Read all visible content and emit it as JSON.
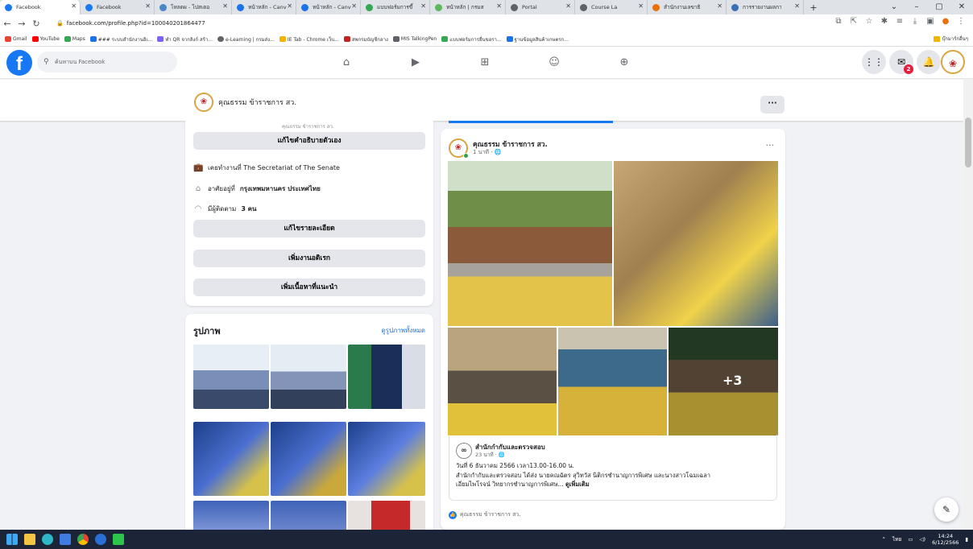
{
  "browser": {
    "tabs": [
      {
        "label": "Facebook",
        "color": "#1877f2",
        "active": true
      },
      {
        "label": "Facebook",
        "color": "#1877f2"
      },
      {
        "label": "โหลดผ - โปสเตอ",
        "color": "#4a86c8"
      },
      {
        "label": "หน้าหลัก - Canv",
        "color": "#1a73e8"
      },
      {
        "label": "หน้าหลัก - Canv",
        "color": "#1a73e8"
      },
      {
        "label": "แบบฟอร์มการขึ้",
        "color": "#34a853"
      },
      {
        "label": "หน้าหลัก | กรมส",
        "color": "#5bb85d"
      },
      {
        "label": "Portal",
        "color": "#5f6368"
      },
      {
        "label": "Course La",
        "color": "#5f6368"
      },
      {
        "label": "สำนักงานเลขาธิ",
        "color": "#e8710a"
      },
      {
        "label": "การรายงานผลกา",
        "color": "#3b6fb6"
      }
    ],
    "url": "facebook.com/profile.php?id=100040201864477",
    "bookmarks": [
      {
        "label": "Gmail",
        "color": "#ea4335"
      },
      {
        "label": "YouTube",
        "color": "#ff0000"
      },
      {
        "label": "Maps",
        "color": "#34a853"
      },
      {
        "label": "### ระบบสำนักงานอิเ...",
        "color": "#1a73e8"
      },
      {
        "label": "ทำ QR จากลิงก์ สร้า...",
        "color": "#7b61ff"
      },
      {
        "label": "e-Learning | กรมส่ง...",
        "color": "#5f6368"
      },
      {
        "label": "IE Tab - Chrome เว็บ...",
        "color": "#f4b400"
      },
      {
        "label": "สพกรมบัญชีกลาง",
        "color": "#c5221f"
      },
      {
        "label": "MIS TalkingPen",
        "color": "#5f6368"
      },
      {
        "label": "แบบฟอร์มการยื่นขอรา...",
        "color": "#34a853"
      },
      {
        "label": "ฐานข้อมูลสินค้าเกษตรก...",
        "color": "#1a73e8"
      }
    ],
    "bookmarks_other": "บุ๊กมาร์กอื่นๆ",
    "window_controls": [
      "⌄",
      "–",
      "▢",
      "✕"
    ]
  },
  "fb": {
    "search_placeholder": "ค้นหาบน Facebook",
    "notification_count": "2",
    "profile_name": "คุณธรรม ข้าราชการ สว.",
    "intro": {
      "cut_text": "คุณธรรม ข้าราชการ สว.",
      "edit_bio": "แก้ไขคำอธิบายตัวเอง",
      "work": "เคยทำงานที่ The Secretariat of The Senate",
      "live_prefix": "อาศัยอยู่ที่ ",
      "live_place": "กรุงเทพมหานคร ประเทศไทย",
      "followers_prefix": "มีผู้ติดตาม ",
      "followers_count": "3 คน",
      "edit_details": "แก้ไขรายละเอียด",
      "add_hobbies": "เพิ่มงานอดิเรก",
      "add_featured": "เพิ่มเนื้อหาที่แนะนำ"
    },
    "photos": {
      "title": "รูปภาพ",
      "see_all": "ดูรูปภาพทั้งหมด"
    },
    "post": {
      "author": "คุณธรรม ข้าราชการ สว.",
      "time": "1 นาที · 🌐",
      "more_count": "+3",
      "shared_author": "สำนักกำกับและตรวจสอบ",
      "shared_time": "23 นาที · 🌐",
      "shared_text_line1": "วันที่ 6 ธันวาคม 2566 เวลา13.00-16.00 น.",
      "shared_text_line2": "สำนักกำกับและตรวจสอบ ได้ส่ง นายคณฉัตร สุวิทวัส นิติกรชำนาญการพิเศษ และนางสาวโฉมเฉลา",
      "shared_text_line3": "เอี่ยมไพโรจน์ วิทยากรชำนาญการพิเศษ... ",
      "see_more": "ดูเพิ่มเติม",
      "reaction_name": "คุณธรรม ข้าราชการ สว."
    }
  },
  "taskbar": {
    "lang": "ไทย",
    "time": "14:24",
    "date": "6/12/2566"
  }
}
